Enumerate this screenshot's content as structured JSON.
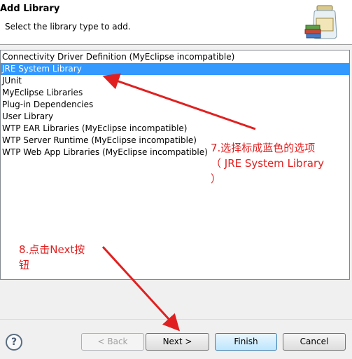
{
  "dialog": {
    "title": "Add Library",
    "subtitle": "Select the library type to add.",
    "icon": "library-jar-icon"
  },
  "library_types": {
    "items": [
      {
        "label": "Connectivity Driver Definition (MyEclipse incompatible)",
        "selected": false
      },
      {
        "label": "JRE System Library",
        "selected": true
      },
      {
        "label": "JUnit",
        "selected": false
      },
      {
        "label": "MyEclipse Libraries",
        "selected": false
      },
      {
        "label": "Plug-in Dependencies",
        "selected": false
      },
      {
        "label": "User Library",
        "selected": false
      },
      {
        "label": "WTP EAR Libraries (MyEclipse incompatible)",
        "selected": false
      },
      {
        "label": "WTP Server Runtime (MyEclipse incompatible)",
        "selected": false
      },
      {
        "label": "WTP Web App Libraries (MyEclipse incompatible)",
        "selected": false
      }
    ]
  },
  "buttons": {
    "help": "?",
    "back": "< Back",
    "next": "Next >",
    "finish": "Finish",
    "cancel": "Cancel"
  },
  "annotations": {
    "step7_line1": "7.选择标成蓝色的选项",
    "step7_line2": "（ JRE System Library",
    "step7_line3": "）",
    "step8_line1": "8.点击Next按",
    "step8_line2": "钮"
  },
  "colors": {
    "selection": "#3399ff",
    "annotation_red": "#e02020"
  }
}
